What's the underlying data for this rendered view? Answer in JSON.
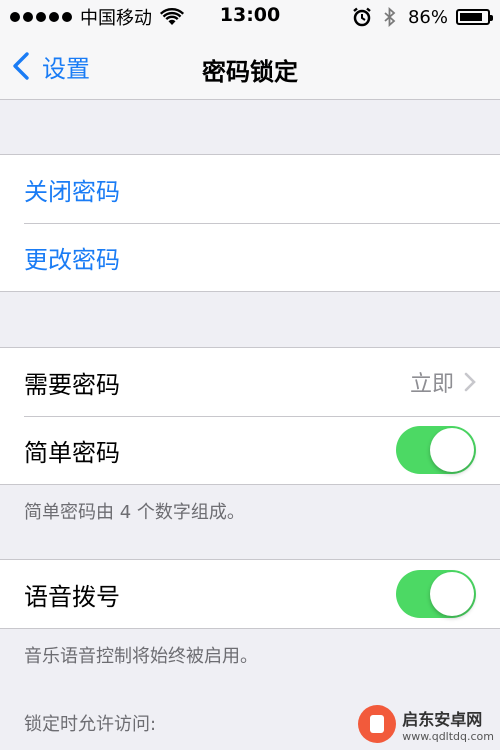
{
  "status_bar": {
    "carrier": "中国移动",
    "time": "13:00",
    "battery_percent": "86%",
    "battery_level": 0.86,
    "icons": [
      "signal-dots",
      "wifi-icon",
      "alarm-icon",
      "bluetooth-icon",
      "battery-icon"
    ]
  },
  "nav": {
    "back_label": "设置",
    "title": "密码锁定"
  },
  "group1": {
    "items": [
      {
        "label": "关闭密码"
      },
      {
        "label": "更改密码"
      }
    ]
  },
  "group2": {
    "require_passcode": {
      "label": "需要密码",
      "value": "立即"
    },
    "simple_passcode": {
      "label": "简单密码",
      "on": true
    },
    "footnote": "简单密码由 4 个数字组成。"
  },
  "group3": {
    "voice_dial": {
      "label": "语音拨号",
      "on": true
    },
    "footnote": "音乐语音控制将始终被启用。"
  },
  "section4": {
    "header": "锁定时允许访问:"
  },
  "watermark": {
    "title": "启东安卓网",
    "url": "www.qdltdq.com"
  },
  "colors": {
    "accent": "#1a7cf5",
    "toggle_on": "#4cd964",
    "background": "#efeff4"
  }
}
